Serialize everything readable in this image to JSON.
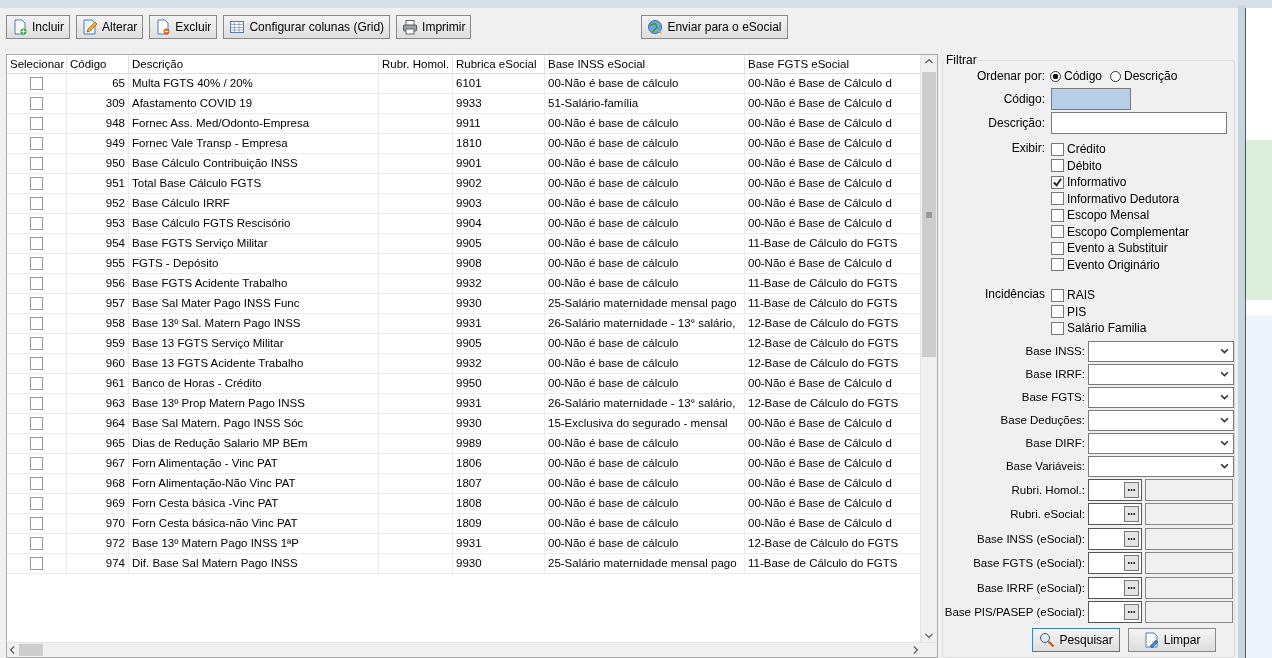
{
  "toolbar": [
    {
      "label": "Incluir",
      "kind": "add"
    },
    {
      "label": "Alterar",
      "kind": "edit"
    },
    {
      "label": "Excluir",
      "kind": "delete"
    },
    {
      "label": "Configurar colunas (Grid)",
      "kind": "grid"
    },
    {
      "label": "Imprimir",
      "kind": "print"
    }
  ],
  "send_button": {
    "label": "Enviar para o eSocial",
    "kind": "send"
  },
  "table": {
    "columns": [
      "Selecionar",
      "Código",
      "Descrição",
      "Rubr. Homol.",
      "Rubrica eSocial",
      "Base INSS eSocial",
      "Base FGTS eSocial"
    ],
    "rows": [
      {
        "checked": false,
        "codigo": "65",
        "descricao": "Multa FGTS 40% / 20%",
        "rubrica": "6101",
        "base_inss": "00-Não é base de cálculo",
        "base_fgts": "00-Não é Base de Cálculo d"
      },
      {
        "checked": false,
        "codigo": "309",
        "descricao": "Afastamento COVID 19",
        "rubrica": "9933",
        "base_inss": "51-Salário-família",
        "base_fgts": "00-Não é Base de Cálculo d"
      },
      {
        "checked": false,
        "codigo": "948",
        "descricao": "Fornec Ass. Med/Odonto-Empresa",
        "rubrica": "9911",
        "base_inss": "00-Não é base de cálculo",
        "base_fgts": "00-Não é Base de Cálculo d"
      },
      {
        "checked": false,
        "codigo": "949",
        "descricao": "Fornec Vale Transp - Empresa",
        "rubrica": "1810",
        "base_inss": "00-Não é base de cálculo",
        "base_fgts": "00-Não é Base de Cálculo d"
      },
      {
        "checked": false,
        "codigo": "950",
        "descricao": "Base Cálculo Contribuição INSS",
        "rubrica": "9901",
        "base_inss": "00-Não é base de cálculo",
        "base_fgts": "00-Não é Base de Cálculo d"
      },
      {
        "checked": false,
        "codigo": "951",
        "descricao": "Total Base Cálculo FGTS",
        "rubrica": "9902",
        "base_inss": "00-Não é base de cálculo",
        "base_fgts": "00-Não é Base de Cálculo d"
      },
      {
        "checked": false,
        "codigo": "952",
        "descricao": "Base Cálculo IRRF",
        "rubrica": "9903",
        "base_inss": "00-Não é base de cálculo",
        "base_fgts": "00-Não é Base de Cálculo d"
      },
      {
        "checked": false,
        "codigo": "953",
        "descricao": "Base Cálculo FGTS Rescisório",
        "rubrica": "9904",
        "base_inss": "00-Não é base de cálculo",
        "base_fgts": "00-Não é Base de Cálculo d"
      },
      {
        "checked": false,
        "codigo": "954",
        "descricao": "Base FGTS Serviço Militar",
        "rubrica": "9905",
        "base_inss": "00-Não é base de cálculo",
        "base_fgts": "11-Base de Cálculo do FGTS"
      },
      {
        "checked": false,
        "codigo": "955",
        "descricao": "FGTS - Depósito",
        "rubrica": "9908",
        "base_inss": "00-Não é base de cálculo",
        "base_fgts": "00-Não é Base de Cálculo d"
      },
      {
        "checked": false,
        "codigo": "956",
        "descricao": "Base FGTS Acidente Trabalho",
        "rubrica": "9932",
        "base_inss": "00-Não é base de cálculo",
        "base_fgts": "11-Base de Cálculo do FGTS"
      },
      {
        "checked": false,
        "codigo": "957",
        "descricao": "Base Sal Mater Pago INSS Func",
        "rubrica": "9930",
        "base_inss": "25-Salário maternidade mensal pago",
        "base_fgts": "11-Base de Cálculo do FGTS"
      },
      {
        "checked": false,
        "codigo": "958",
        "descricao": "Base 13º Sal. Matern Pago INSS",
        "rubrica": "9931",
        "base_inss": "26-Salário maternidade - 13° salário,",
        "base_fgts": "12-Base de Cálculo do FGTS"
      },
      {
        "checked": false,
        "codigo": "959",
        "descricao": "Base 13 FGTS Serviço Militar",
        "rubrica": "9905",
        "base_inss": "00-Não é base de cálculo",
        "base_fgts": "12-Base de Cálculo do FGTS"
      },
      {
        "checked": false,
        "codigo": "960",
        "descricao": "Base 13 FGTS Acidente Trabalho",
        "rubrica": "9932",
        "base_inss": "00-Não é base de cálculo",
        "base_fgts": "12-Base de Cálculo do FGTS"
      },
      {
        "checked": false,
        "codigo": "961",
        "descricao": "Banco de Horas - Crédito",
        "rubrica": "9950",
        "base_inss": "00-Não é base de cálculo",
        "base_fgts": "00-Não é Base de Cálculo d"
      },
      {
        "checked": false,
        "codigo": "963",
        "descricao": "Base 13º Prop Matern Pago INSS",
        "rubrica": "9931",
        "base_inss": "26-Salário maternidade - 13° salário,",
        "base_fgts": "12-Base de Cálculo do FGTS"
      },
      {
        "checked": false,
        "codigo": "964",
        "descricao": "Base Sal Matern. Pago INSS Sóc",
        "rubrica": "9930",
        "base_inss": "15-Exclusiva do segurado - mensal",
        "base_fgts": "00-Não é Base de Cálculo d"
      },
      {
        "checked": false,
        "codigo": "965",
        "descricao": "Dias de Redução Salario MP BEm",
        "rubrica": "9989",
        "base_inss": "00-Não é base de cálculo",
        "base_fgts": "00-Não é Base de Cálculo d"
      },
      {
        "checked": false,
        "codigo": "967",
        "descricao": "Forn Alimentação - Vinc PAT",
        "rubrica": "1806",
        "base_inss": "00-Não é base de cálculo",
        "base_fgts": "00-Não é Base de Cálculo d"
      },
      {
        "checked": false,
        "codigo": "968",
        "descricao": "Forn Alimentação-Não Vinc PAT",
        "rubrica": "1807",
        "base_inss": "00-Não é base de cálculo",
        "base_fgts": "00-Não é Base de Cálculo d"
      },
      {
        "checked": false,
        "codigo": "969",
        "descricao": "Forn Cesta básica -Vinc PAT",
        "rubrica": "1808",
        "base_inss": "00-Não é base de cálculo",
        "base_fgts": "00-Não é Base de Cálculo d"
      },
      {
        "checked": false,
        "codigo": "970",
        "descricao": "Forn Cesta básica-não Vinc PAT",
        "rubrica": "1809",
        "base_inss": "00-Não é base de cálculo",
        "base_fgts": "00-Não é Base de Cálculo d"
      },
      {
        "checked": false,
        "codigo": "972",
        "descricao": "Base 13º Matern Pago INSS 1ªP",
        "rubrica": "9931",
        "base_inss": "00-Não é base de cálculo",
        "base_fgts": "12-Base de Cálculo do FGTS"
      },
      {
        "checked": false,
        "codigo": "974",
        "descricao": "Dif. Base Sal Matern Pago INSS",
        "rubrica": "9930",
        "base_inss": "25-Salário maternidade mensal pago",
        "base_fgts": "11-Base de Cálculo do FGTS"
      }
    ]
  },
  "filter": {
    "title": "Filtrar",
    "order_by": {
      "label": "Ordenar por:",
      "options": [
        {
          "label": "Código",
          "selected": true
        },
        {
          "label": "Descrição",
          "selected": false
        }
      ]
    },
    "fields": [
      {
        "label": "Código:",
        "focused": true
      },
      {
        "label": "Descrição:",
        "focused": false
      }
    ],
    "groups": [
      {
        "label": "Exibir:",
        "options": [
          {
            "label": "Crédito",
            "checked": false
          },
          {
            "label": "Débito",
            "checked": false
          },
          {
            "label": "Informativo",
            "checked": true
          },
          {
            "label": "Informativo Dedutora",
            "checked": false
          },
          {
            "label": "Escopo Mensal",
            "checked": false
          },
          {
            "label": "Escopo Complementar",
            "checked": false
          },
          {
            "label": "Evento a Substituir",
            "checked": false
          },
          {
            "label": "Evento Originário",
            "checked": false
          }
        ]
      },
      {
        "label": "Incidências",
        "options": [
          {
            "label": "RAIS",
            "checked": false
          },
          {
            "label": "PIS",
            "checked": false
          },
          {
            "label": "Salário Familia",
            "checked": false
          }
        ]
      }
    ],
    "dropdowns": [
      {
        "label": "Base INSS:"
      },
      {
        "label": "Base IRRF:"
      },
      {
        "label": "Base FGTS:"
      },
      {
        "label": "Base Deduções:"
      },
      {
        "label": "Base DIRF:"
      },
      {
        "label": "Base Variáveis:"
      }
    ],
    "lookups": [
      {
        "label": "Rubri. Homol.:"
      },
      {
        "label": "Rubri. eSocial:"
      },
      {
        "label": "Base INSS (eSocial):"
      },
      {
        "label": "Base FGTS (eSocial):"
      },
      {
        "label": "Base IRRF (eSocial):"
      },
      {
        "label": "Base PIS/PASEP (eSocial):"
      }
    ],
    "buttons": [
      {
        "label": "Pesquisar",
        "kind": "search"
      },
      {
        "label": "Limpar",
        "kind": "clear"
      }
    ]
  }
}
